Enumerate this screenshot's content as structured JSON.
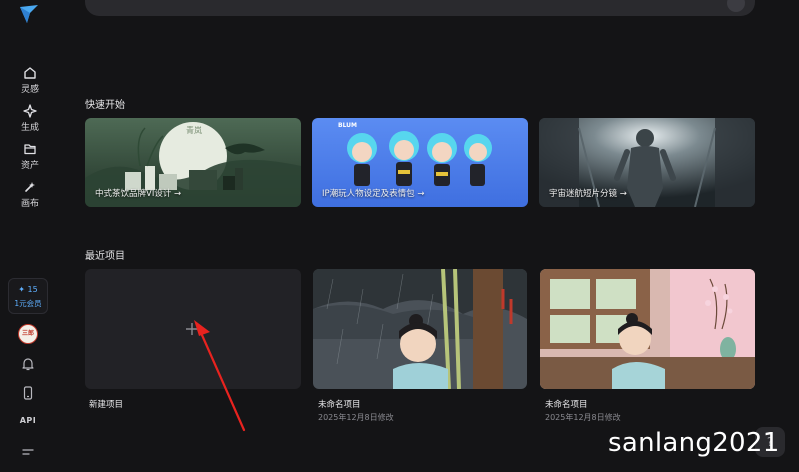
{
  "sidebar": {
    "nav": [
      {
        "label": "灵感",
        "icon": "home-icon"
      },
      {
        "label": "生成",
        "icon": "sparkle-icon"
      },
      {
        "label": "资产",
        "icon": "folder-icon"
      },
      {
        "label": "画布",
        "icon": "canvas-icon"
      }
    ],
    "credits": {
      "count": "✦ 15",
      "label": "1元会员"
    },
    "avatar_text": "三郎",
    "api_label": "API"
  },
  "quick_start": {
    "title": "快速开始",
    "cards": [
      {
        "label": "中式茶饮品牌VI设计 →",
        "sign": "青岚"
      },
      {
        "label": "IP潮玩人物设定及表情包 →",
        "badge": "BLUM"
      },
      {
        "label": "宇宙迷航短片分镜 →"
      }
    ]
  },
  "recent": {
    "title": "最近项目",
    "new_label": "新建项目",
    "projects": [
      {
        "title": "未命名项目",
        "date": "2025年12月8日修改"
      },
      {
        "title": "未命名项目",
        "date": "2025年12月8日修改"
      }
    ]
  },
  "watermark": "sanlang2021",
  "help_symbol": "?",
  "colors": {
    "background": "#141416",
    "accent": "#5fb0ff",
    "card": "#222226"
  }
}
